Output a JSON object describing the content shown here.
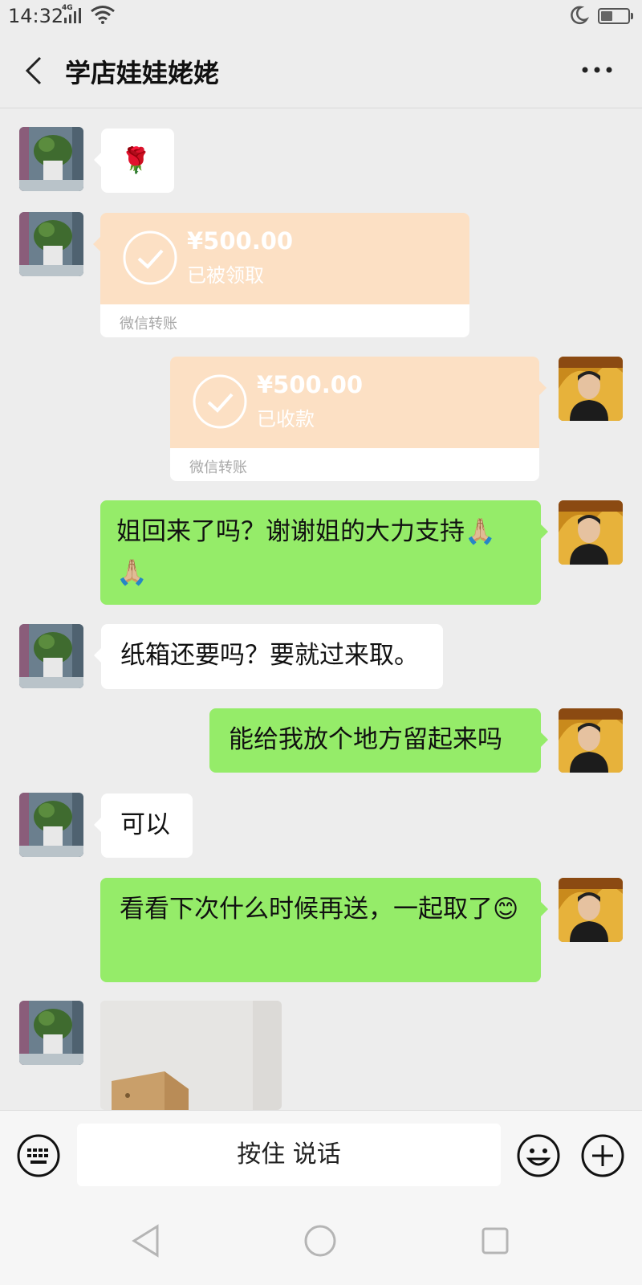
{
  "status_bar": {
    "time": "14:32",
    "network": "4G"
  },
  "header": {
    "title": "学店娃娃姥姥",
    "back_icon": "chevron-left-icon",
    "more_icon": "more-dots-icon"
  },
  "messages": [
    {
      "side": "in",
      "type": "emoji",
      "text": "🌹"
    },
    {
      "side": "in",
      "type": "transfer",
      "amount": "¥500.00",
      "status": "已被领取",
      "label": "微信转账"
    },
    {
      "side": "out",
      "type": "transfer",
      "amount": "¥500.00",
      "status": "已收款",
      "label": "微信转账"
    },
    {
      "side": "out",
      "type": "text",
      "text": "姐回来了吗？谢谢姐的大力支持🙏🏼🙏🏼"
    },
    {
      "side": "in",
      "type": "text",
      "text": "纸箱还要吗？要就过来取。"
    },
    {
      "side": "out",
      "type": "text",
      "text": "能给我放个地方留起来吗"
    },
    {
      "side": "in",
      "type": "text",
      "text": "可以"
    },
    {
      "side": "out",
      "type": "text",
      "text": "看看下次什么时候再送，一起取了😊"
    },
    {
      "side": "in",
      "type": "image"
    }
  ],
  "input_bar": {
    "voice_label": "按住 说话"
  },
  "colors": {
    "background": "#ededed",
    "out_bubble": "#95ec69",
    "in_bubble": "#ffffff",
    "transfer": "#fce0c4"
  }
}
